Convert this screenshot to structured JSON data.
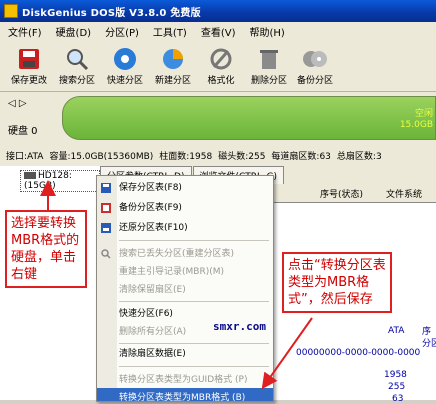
{
  "window": {
    "title": "DiskGenius DOS版 V3.8.0 免费版"
  },
  "menu": [
    "文件(F)",
    "硬盘(D)",
    "分区(P)",
    "工具(T)",
    "查看(V)",
    "帮助(H)"
  ],
  "toolbar": [
    {
      "label": "保存更改",
      "icon": "save-icon"
    },
    {
      "label": "搜索分区",
      "icon": "search-icon"
    },
    {
      "label": "快速分区",
      "icon": "disk-icon"
    },
    {
      "label": "新建分区",
      "icon": "new-partition-icon"
    },
    {
      "label": "格式化",
      "icon": "format-icon"
    },
    {
      "label": "删除分区",
      "icon": "trash-icon"
    },
    {
      "label": "备份分区",
      "icon": "backup-icon"
    }
  ],
  "disk_nav": {
    "arrows": "◁ ▷",
    "label": "硬盘 0"
  },
  "disk_bar": {
    "free_label": "空闲",
    "free_size": "15.0GB"
  },
  "disk_info": [
    "接口:ATA",
    "容量:15.0GB(15360MB)",
    "柱面数:1958",
    "磁头数:255",
    "每道扇区数:63",
    "总扇区数:3"
  ],
  "tree": {
    "disk_item": "HD128: (15GB)"
  },
  "tabs": [
    "分区参数(CTRL_D)",
    "浏览文件(CTRL_G)"
  ],
  "columns": [
    "序号(状态)",
    "文件系统"
  ],
  "detail": {
    "interface": "ATA",
    "serial_label": "序",
    "partition_label": "分区",
    "guid": "00000000-0000-0000-0000",
    "cylinders": "1958",
    "heads": "255",
    "sectors": "63"
  },
  "context_menu": [
    {
      "label": "保存分区表(F8)",
      "icon": "save-icon",
      "disabled": false
    },
    {
      "label": "备份分区表(F9)",
      "icon": "backup-icon",
      "disabled": false
    },
    {
      "label": "还原分区表(F10)",
      "icon": "restore-icon",
      "disabled": false
    },
    {
      "label": "搜索已丢失分区(重建分区表)",
      "icon": "search-icon",
      "disabled": true
    },
    {
      "label": "重建主引导记录(MBR)(M)",
      "icon": "",
      "disabled": true
    },
    {
      "label": "清除保留扇区(E)",
      "icon": "",
      "disabled": true
    },
    {
      "label": "快速分区(F6)",
      "icon": "",
      "disabled": false
    },
    {
      "label": "删除所有分区(A)",
      "icon": "",
      "disabled": true
    },
    {
      "label": "清除扇区数据(E)",
      "icon": "",
      "disabled": false
    },
    {
      "label": "转换分区表类型为GUID格式 (P)",
      "icon": "",
      "disabled": true
    },
    {
      "label": "转换分区表类型为MBR格式 (B)",
      "icon": "",
      "disabled": false
    }
  ],
  "watermark": "smxr.com",
  "callouts": {
    "left": "选择要转换MBR格式的硬盘，单击右键",
    "right": "点击“转换分区表类型为MBR格式”，然后保存"
  },
  "colors": {
    "title": "#0838a8",
    "highlight": "#316ac5",
    "callout": "#e02020",
    "diskbar": "#7cc04a"
  }
}
